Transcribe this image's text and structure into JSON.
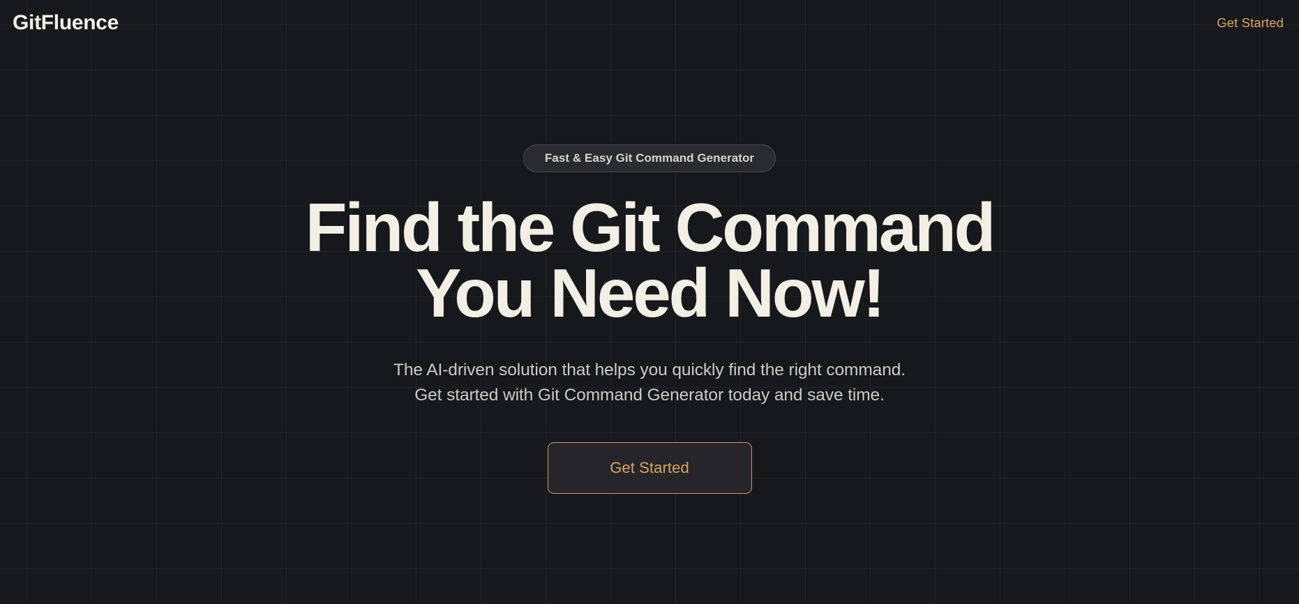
{
  "meta": {
    "background_color": "#17181c",
    "accent_color": "#d9a65c",
    "heading_color": "#f2efe4",
    "grid_line_color": "rgba(255,255,255,0.045)"
  },
  "header": {
    "brand": "GitFluence",
    "cta_link_label": "Get Started"
  },
  "hero": {
    "badge_label": "Fast & Easy Git Command Generator",
    "heading_line_1": "Find the Git Command",
    "heading_line_2": "You Need Now!",
    "subtext_line_1": "The AI-driven solution that helps you quickly find the right command.",
    "subtext_line_2": "Get started with Git Command Generator today and save time.",
    "cta_button_label": "Get Started"
  }
}
